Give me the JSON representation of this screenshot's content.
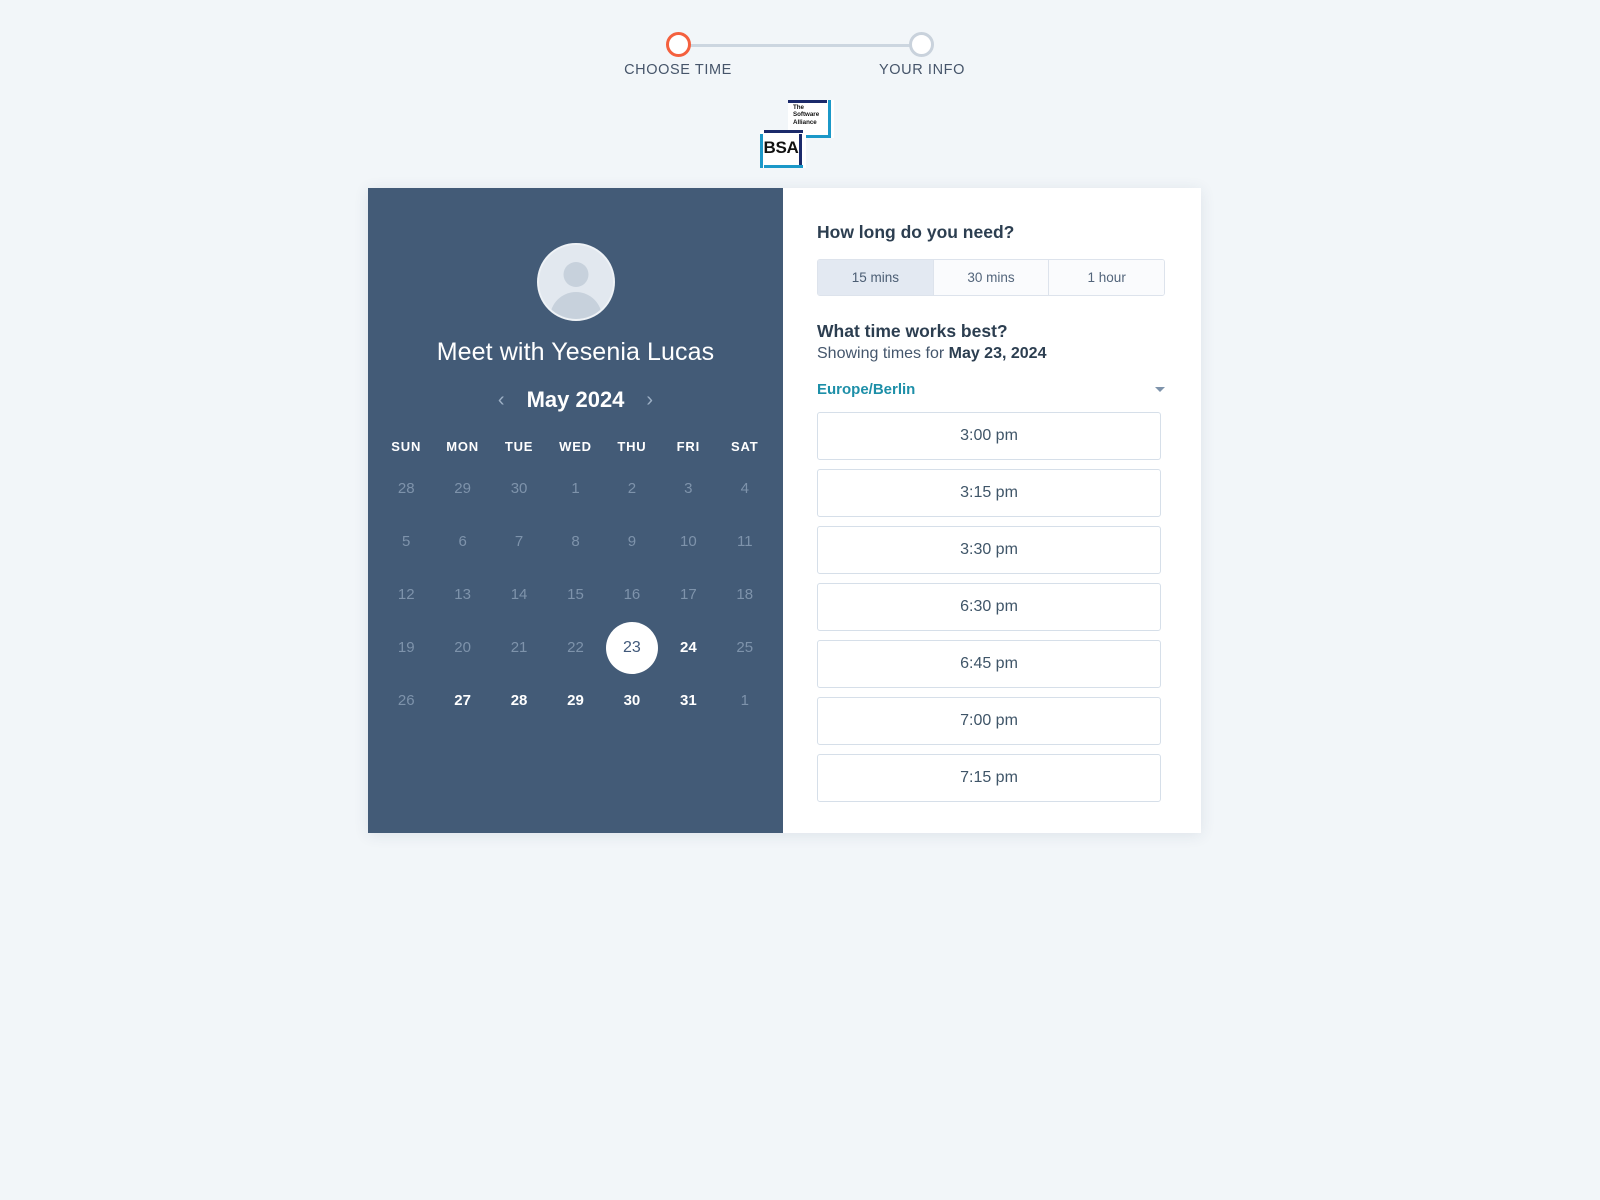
{
  "stepper": {
    "steps": [
      {
        "label": "CHOOSE TIME",
        "state": "active"
      },
      {
        "label": "YOUR INFO",
        "state": "inactive"
      }
    ],
    "active_color": "#f4603e",
    "inactive_color": "#c9d2dc"
  },
  "logo": {
    "mark": "BSA",
    "tagline_line1": "The",
    "tagline_line2": "Software",
    "tagline_line3": "Alliance",
    "navy": "#1b2a6b",
    "cyan": "#1b98c8"
  },
  "left_panel": {
    "avatar_icon": "person-avatar-icon",
    "meeting_title": "Meet with Yesenia Lucas",
    "prev_arrow": "‹",
    "next_arrow": "›",
    "month_label": "May 2024",
    "weekdays": [
      "SUN",
      "MON",
      "TUE",
      "WED",
      "THU",
      "FRI",
      "SAT"
    ],
    "background": "#435b77",
    "days": [
      {
        "n": "28",
        "state": "muted"
      },
      {
        "n": "29",
        "state": "muted"
      },
      {
        "n": "30",
        "state": "muted"
      },
      {
        "n": "1",
        "state": "muted"
      },
      {
        "n": "2",
        "state": "muted"
      },
      {
        "n": "3",
        "state": "muted"
      },
      {
        "n": "4",
        "state": "muted"
      },
      {
        "n": "5",
        "state": "muted"
      },
      {
        "n": "6",
        "state": "muted"
      },
      {
        "n": "7",
        "state": "muted"
      },
      {
        "n": "8",
        "state": "muted"
      },
      {
        "n": "9",
        "state": "muted"
      },
      {
        "n": "10",
        "state": "muted"
      },
      {
        "n": "11",
        "state": "muted"
      },
      {
        "n": "12",
        "state": "muted"
      },
      {
        "n": "13",
        "state": "muted"
      },
      {
        "n": "14",
        "state": "muted"
      },
      {
        "n": "15",
        "state": "muted"
      },
      {
        "n": "16",
        "state": "muted"
      },
      {
        "n": "17",
        "state": "muted"
      },
      {
        "n": "18",
        "state": "muted"
      },
      {
        "n": "19",
        "state": "muted"
      },
      {
        "n": "20",
        "state": "muted"
      },
      {
        "n": "21",
        "state": "muted"
      },
      {
        "n": "22",
        "state": "muted"
      },
      {
        "n": "23",
        "state": "selected"
      },
      {
        "n": "24",
        "state": "available"
      },
      {
        "n": "25",
        "state": "muted"
      },
      {
        "n": "26",
        "state": "muted"
      },
      {
        "n": "27",
        "state": "available"
      },
      {
        "n": "28",
        "state": "available"
      },
      {
        "n": "29",
        "state": "available"
      },
      {
        "n": "30",
        "state": "available"
      },
      {
        "n": "31",
        "state": "available"
      },
      {
        "n": "1",
        "state": "muted"
      }
    ]
  },
  "right_panel": {
    "duration_heading": "How long do you need?",
    "durations": [
      {
        "label": "15 mins",
        "selected": true
      },
      {
        "label": "30 mins",
        "selected": false
      },
      {
        "label": "1 hour",
        "selected": false
      }
    ],
    "time_heading": "What time works best?",
    "showing_prefix": "Showing times for ",
    "showing_date": "May 23, 2024",
    "timezone": "Europe/Berlin",
    "timezone_color": "#1d8fa8",
    "caret_icon": "chevron-down-icon",
    "time_slots": [
      "3:00 pm",
      "3:15 pm",
      "3:30 pm",
      "6:30 pm",
      "6:45 pm",
      "7:00 pm",
      "7:15 pm"
    ]
  }
}
